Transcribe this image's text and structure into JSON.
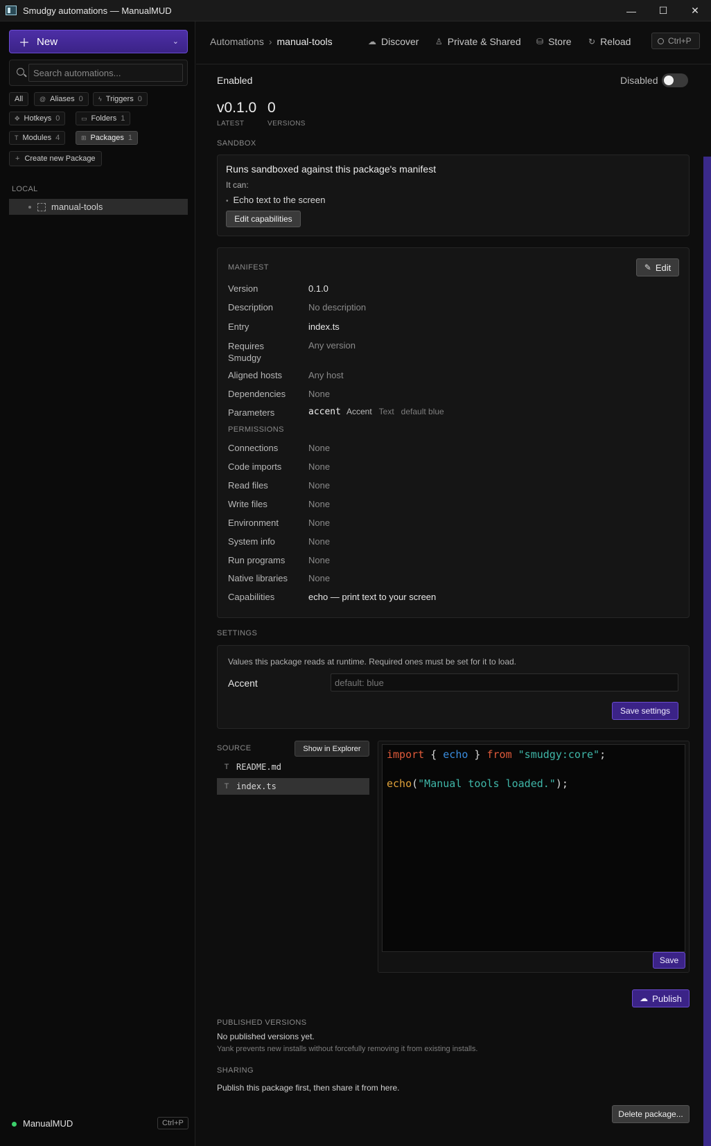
{
  "window": {
    "title": "Smudgy automations — ManualMUD",
    "minimize": "—",
    "maximize": "☐",
    "close": "✕"
  },
  "sidebar": {
    "new_label": "New",
    "search_placeholder": "Search automations...",
    "chips": [
      {
        "label": "All",
        "count": ""
      },
      {
        "label": "Aliases",
        "count": "0"
      },
      {
        "label": "Triggers",
        "count": "0"
      },
      {
        "label": "Hotkeys",
        "count": "0"
      },
      {
        "label": "Folders",
        "count": "1"
      },
      {
        "label": "Modules",
        "count": "4"
      },
      {
        "label": "Packages",
        "count": "1"
      }
    ],
    "create_label": "Create new Package",
    "section_label": "LOCAL",
    "tree_item": "manual-tools",
    "footer": {
      "world": "ManualMUD",
      "shortcut": "Ctrl+P"
    }
  },
  "topbar": {
    "crumb_root": "Automations",
    "crumb_sep": "›",
    "crumb_current": "manual-tools",
    "nav": [
      "Discover",
      "Private & Shared",
      "Store",
      "Reload"
    ],
    "cmd": "Ctrl+P"
  },
  "status": {
    "enabled_label": "Enabled",
    "toggle_label": "Disabled",
    "toggle_on": false
  },
  "version": {
    "latest": "v0.1.0",
    "latest_label": "LATEST",
    "count": "0",
    "count_label": "VERSIONS"
  },
  "sandbox": {
    "section": "SANDBOX",
    "title": "Runs sandboxed against this package's manifest",
    "it_can": "It can:",
    "capabilities": [
      "Echo text to the screen"
    ],
    "edit_button": "Edit capabilities"
  },
  "manifest": {
    "section": "MANIFEST",
    "edit_button": "Edit",
    "rows": [
      {
        "label": "Version",
        "value": "0.1.0",
        "muted": false
      },
      {
        "label": "Description",
        "value": "No description",
        "muted": true
      },
      {
        "label": "Entry",
        "value": "index.ts",
        "muted": false
      },
      {
        "label": "Requires Smudgy",
        "value": "Any version",
        "muted": true
      },
      {
        "label": "Aligned hosts",
        "value": "Any host",
        "muted": true
      },
      {
        "label": "Dependencies",
        "value": "None",
        "muted": true
      }
    ],
    "parameters": {
      "label": "Parameters",
      "name": "accent",
      "display": "Accent",
      "type": "Text",
      "default": "default blue"
    },
    "permissions_label": "PERMISSIONS",
    "permissions": [
      {
        "label": "Connections",
        "value": "None"
      },
      {
        "label": "Code imports",
        "value": "None"
      },
      {
        "label": "Read files",
        "value": "None"
      },
      {
        "label": "Write files",
        "value": "None"
      },
      {
        "label": "Environment",
        "value": "None"
      },
      {
        "label": "System info",
        "value": "None"
      },
      {
        "label": "Run programs",
        "value": "None"
      },
      {
        "label": "Native libraries",
        "value": "None"
      }
    ],
    "capabilities": {
      "label": "Capabilities",
      "value": "echo — print text to your screen"
    }
  },
  "settings": {
    "section": "SETTINGS",
    "description": "Values this package reads at runtime. Required ones must be set for it to load.",
    "field_label": "Accent",
    "field_placeholder": "default: blue",
    "save_button": "Save settings"
  },
  "source": {
    "section": "SOURCE",
    "show_button": "Show in Explorer",
    "files": [
      {
        "name": "README.md",
        "type_icon": "T",
        "active": false
      },
      {
        "name": "index.ts",
        "type_icon": "T",
        "active": true
      }
    ],
    "code": {
      "line1": {
        "kw1": "import",
        "p1": " { ",
        "id": "echo",
        "p2": " } ",
        "kw2": "from",
        "sp": " ",
        "str": "\"smudgy:core\"",
        "end": ";"
      },
      "line2": {
        "fn": "echo",
        "p1": "(",
        "str": "\"Manual tools loaded.\"",
        "end": ");"
      }
    },
    "save_button": "Save"
  },
  "publish_button": "Publish",
  "published": {
    "section": "PUBLISHED VERSIONS",
    "empty": "No published versions yet.",
    "note": "Yank prevents new installs without forcefully removing it from existing installs."
  },
  "sharing": {
    "section": "SHARING",
    "text": "Publish this package first, then share it from here."
  },
  "delete_button": "Delete package...",
  "colors": {
    "accent": "#3b2387",
    "accent_border": "#6a4bd0",
    "status_online": "#3cd06b",
    "keyword": "#e05a3a",
    "identifier": "#3a8ddf",
    "string": "#3fb6a8",
    "function": "#e0a23a"
  }
}
